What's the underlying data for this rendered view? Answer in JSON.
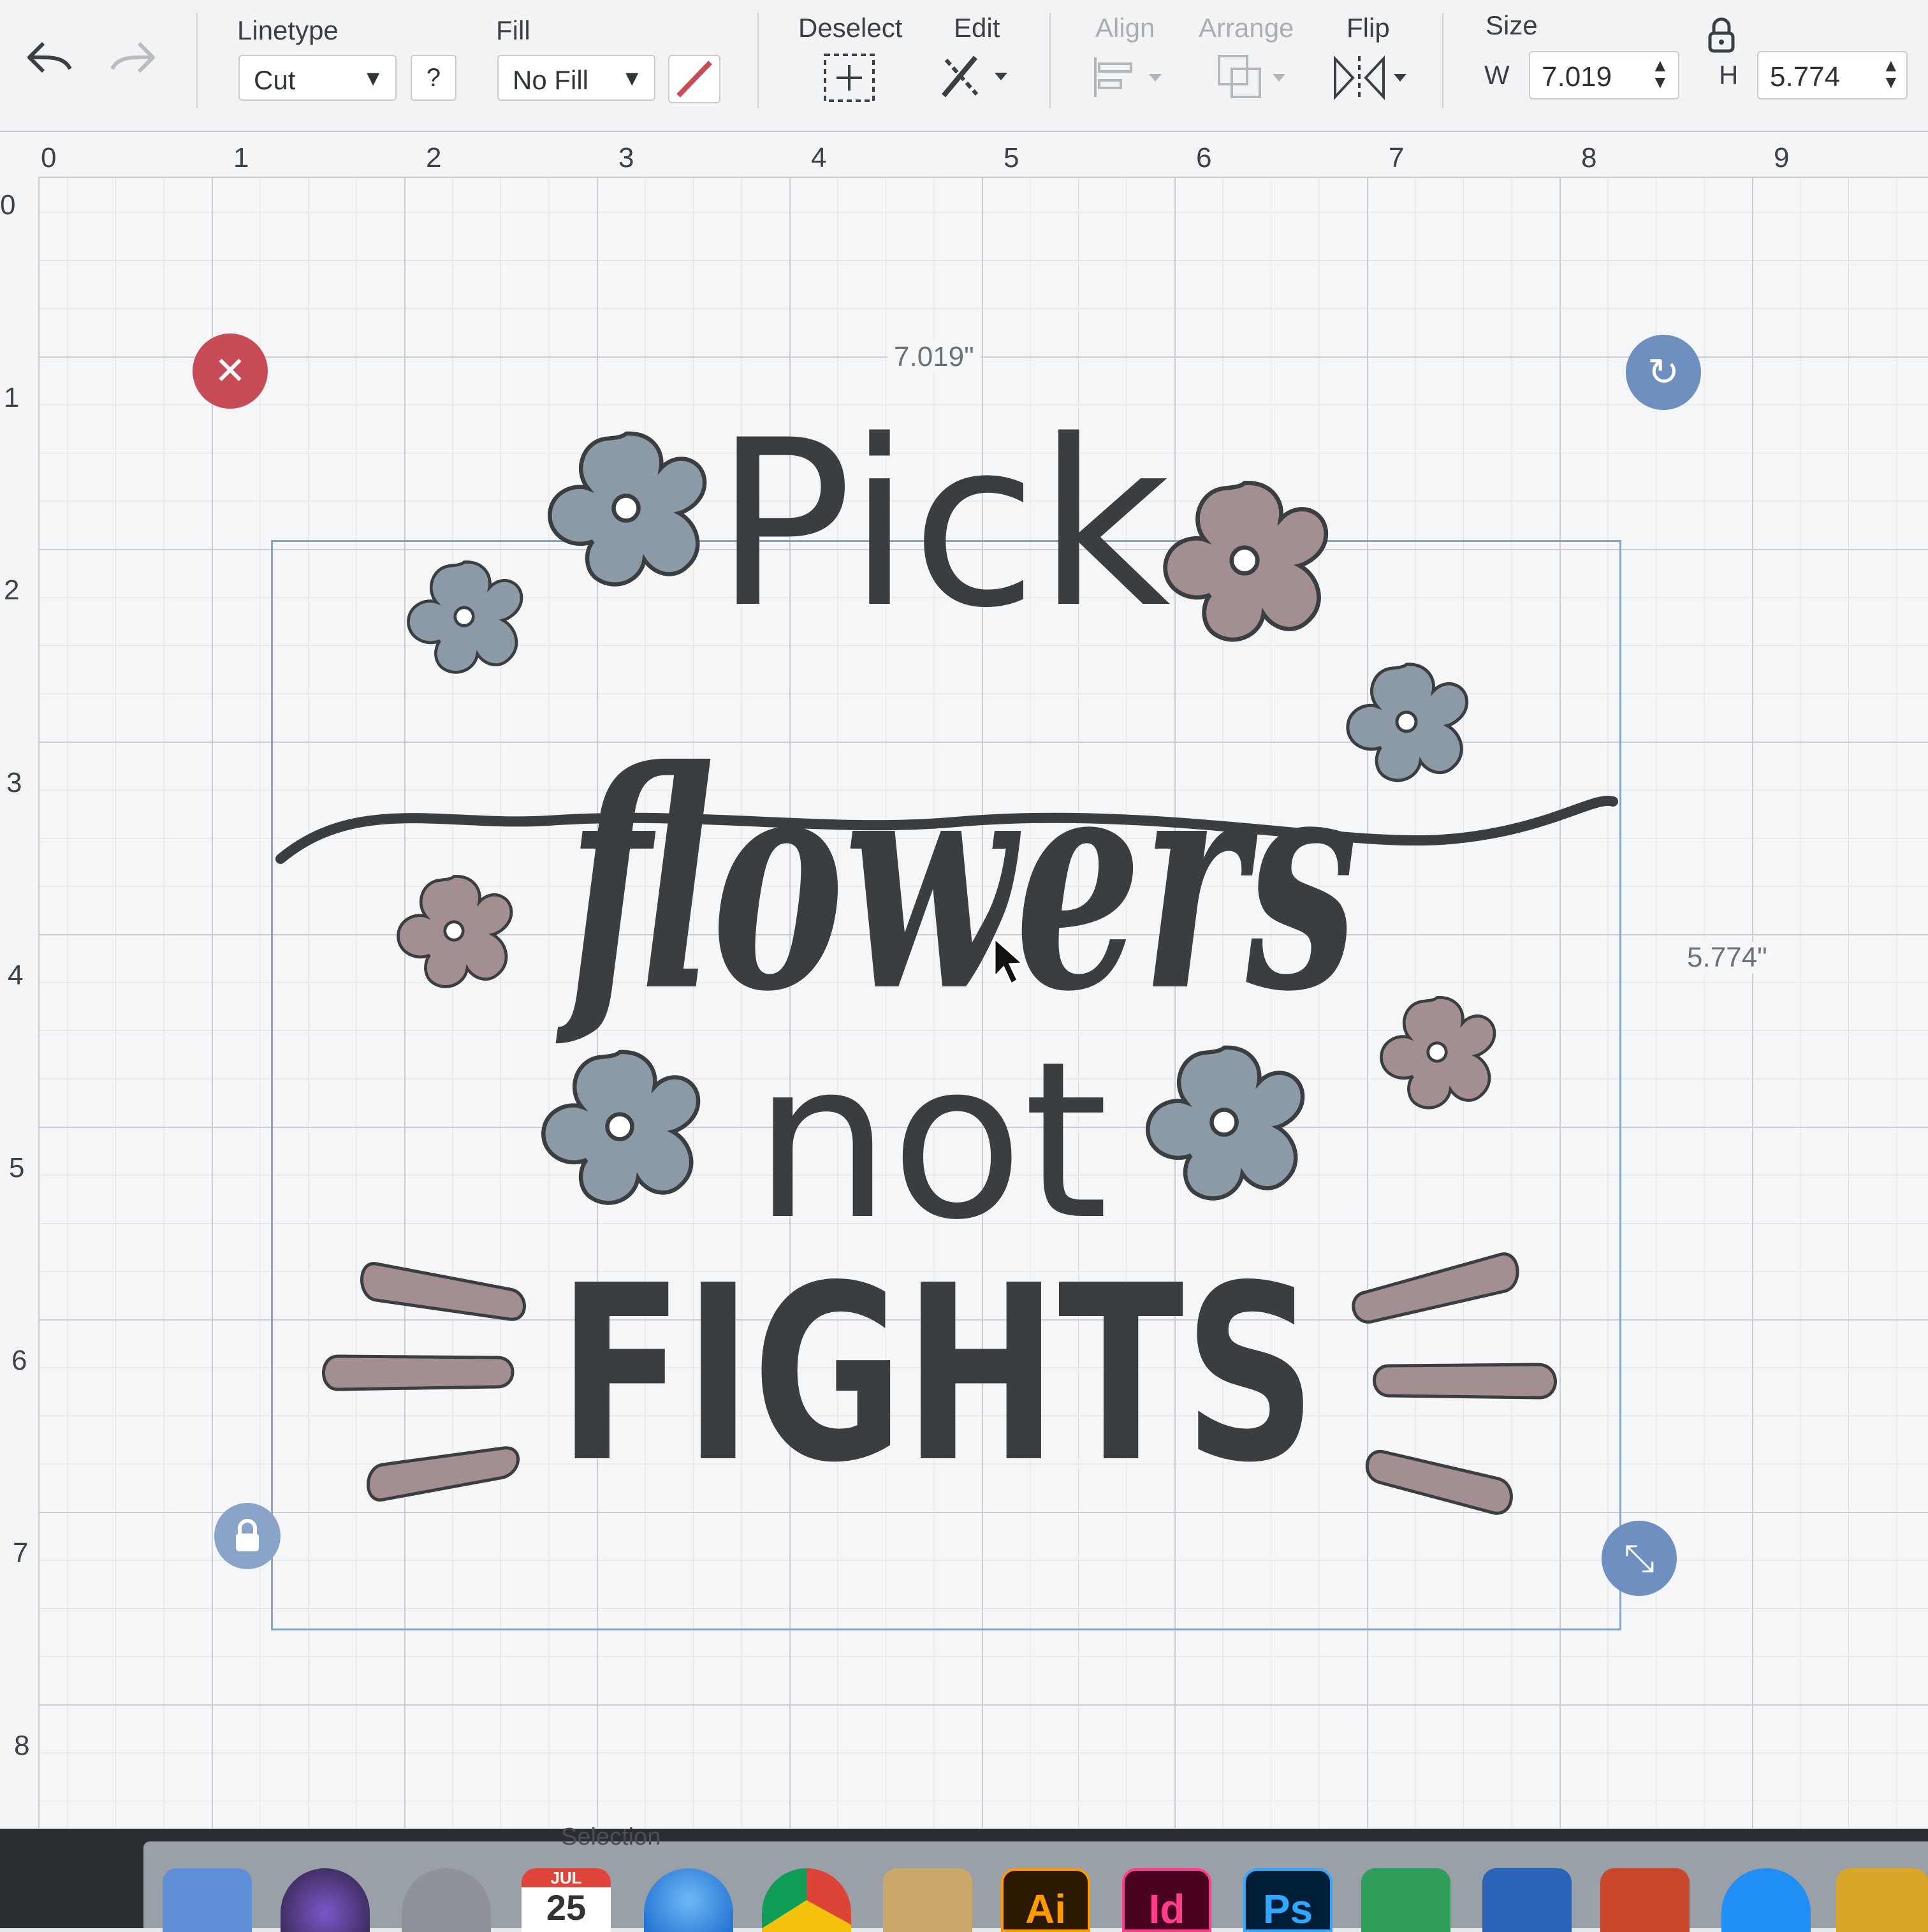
{
  "toolbar": {
    "linetype": {
      "label": "Linetype",
      "value": "Cut",
      "help": "?"
    },
    "fill": {
      "label": "Fill",
      "value": "No Fill"
    },
    "deselect": {
      "label": "Deselect"
    },
    "edit": {
      "label": "Edit"
    },
    "align": {
      "label": "Align"
    },
    "arrange": {
      "label": "Arrange"
    },
    "flip": {
      "label": "Flip"
    },
    "size": {
      "label": "Size",
      "w_label": "W",
      "w_value": "7.019",
      "h_label": "H",
      "h_value": "5.774"
    }
  },
  "rulers": {
    "top": [
      "0",
      "1",
      "2",
      "3",
      "4",
      "5",
      "6",
      "7",
      "8",
      "9"
    ],
    "left": [
      "0",
      "1",
      "2",
      "3",
      "4",
      "5",
      "6",
      "7",
      "8"
    ]
  },
  "canvas": {
    "width_dimension": "7.019\"",
    "height_dimension": "5.774\"",
    "zoom": "100%",
    "design": {
      "line1": "Pick",
      "line2": "flowers",
      "line3": "not",
      "line4": "FIGHTS"
    },
    "colors": {
      "ink": "#3b3e41",
      "flower_blue": "#8b9aa6",
      "flower_mauve": "#a38f91",
      "accent_red": "#c84b58",
      "handle_blue": "#6e8fbf"
    }
  },
  "dock": {
    "calendar_month": "JUL",
    "calendar_day": "25",
    "peek_label": "Selection",
    "apps": [
      "Ai",
      "Id",
      "Ps"
    ]
  }
}
